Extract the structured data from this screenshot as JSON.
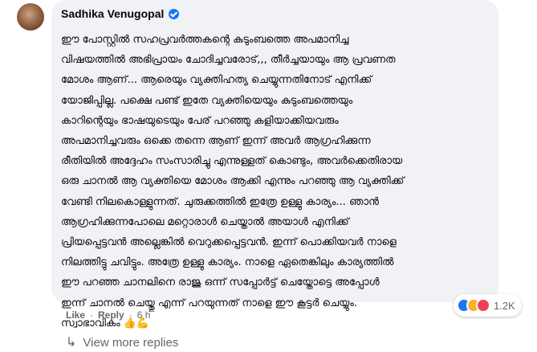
{
  "comment": {
    "author": "Sadhika Venugopal",
    "verified_icon": "verified-badge-icon",
    "text": "ഈ പോസ്റ്റിൽ സഹപ്രവർത്തകന്റെ കുടുംബത്തെ അപമാനിച്ച\nവിഷയത്തിൽ അഭിപ്രായം ചോദിച്ചവരോട്,,, തീർച്ചയായും ആ പ്രവണത\nമോശം ആണ്... ആരെയും വ്യക്തിഹത്യ ചെയ്യുന്നതിനോട് എനിക്ക്\nയോജിപ്പില്ല. പക്ഷെ പണ്ട് ഇതേ വ്യക്തിയെയും കുടുംബത്തെയും\nകാറിന്റെയും ഭാഷയുടെയും പേര് പറഞ്ഞു കളിയാക്കിയവരും\nഅപമാനിച്ചവരും ഒക്കെ തന്നെ ആണ് ഇന്ന് അവർ ആഗ്രഹിക്കുന്ന\nരീതിയിൽ അദ്ദേഹം സംസാരിച്ചു എന്നുള്ളത് കൊണ്ടും, അവർക്കെതിരായ\nഒരു ചാനൽ ആ വ്യക്തിയെ മോശം ആക്കി എന്നും പറഞ്ഞു ആ വ്യക്തിക്ക്\nവേണ്ടി നിലകൊള്ളുന്നത്. ചുരുക്കത്തിൽ ഇത്രേ ഉള്ളു കാര്യം... ഞാൻ\nആഗ്രഹിക്കുന്നപോലെ മറ്റൊരാൾ ചെയ്താൽ അയാൾ എനിക്ക്\nപ്രിയപ്പെട്ടവൻ അല്ലെങ്കിൽ വെറുക്കപ്പെട്ടവൻ. ഇന്ന് പൊക്കിയവർ നാളെ\nനിലത്തിട്ടു ചവിട്ടും. അത്രേ ഉള്ളു കാര്യം. നാളെ ഏതെങ്കിലും കാര്യത്തിൽ\nഈ പറഞ്ഞ ചാനലിനെ രാജു ഒന്ന് സപ്പോർട്ട് ചെയ്തോട്ടെ അപ്പോൾ\nഇന്ന് ചാനൽ ചെയ്തു എന്ന് പറയുന്നത് നാളെ ഈ കൂട്ടർ ചെയ്യും.\nസ്വാഭാവികം",
    "emojis": "👍💪"
  },
  "reactions": {
    "icons": [
      "like-icon",
      "haha-icon",
      "love-icon"
    ],
    "count": "1.2K"
  },
  "actions": {
    "like": "Like",
    "separator": "·",
    "reply": "Reply",
    "time": "6 h"
  },
  "view_more": {
    "icon": "reply-arrow-icon",
    "label": "View more replies"
  }
}
